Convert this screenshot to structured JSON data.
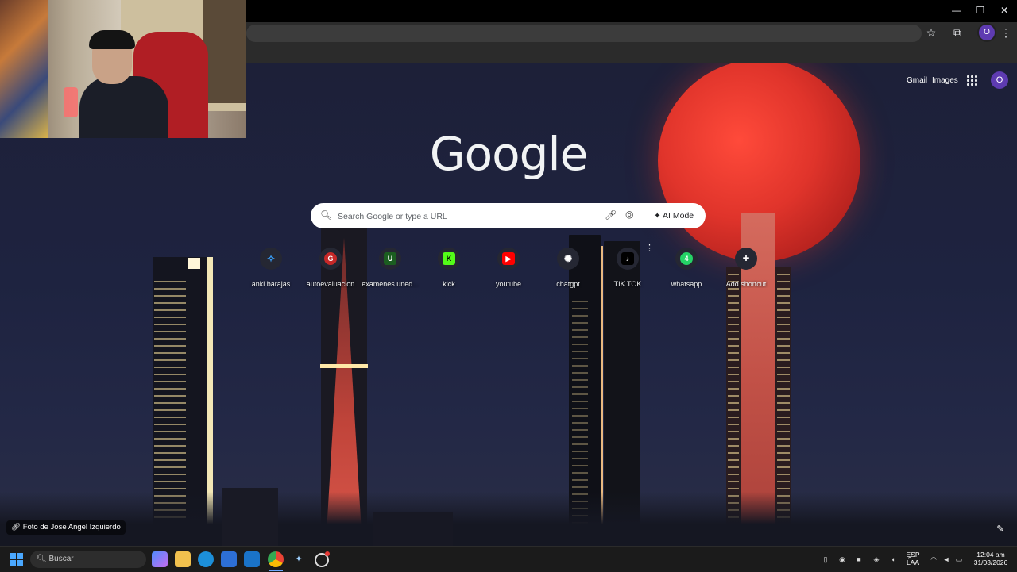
{
  "chrome": {
    "toolbar_icons": [
      "star-icon",
      "extensions-icon",
      "kebab-menu-icon"
    ],
    "profile_initial": "O"
  },
  "header": {
    "gmail": "Gmail",
    "images": "Images",
    "avatar_initial": "O"
  },
  "logo": "Google",
  "search": {
    "placeholder": "Search Google or type a URL",
    "ai_mode": "AI Mode"
  },
  "shortcuts": [
    {
      "label": "anki barajas",
      "icon": "anki-icon",
      "glyph": "✧",
      "color": "#3aa3ff"
    },
    {
      "label": "autoevaluacion",
      "icon": "autoevaluacion-icon",
      "glyph": "G",
      "color": "#c62828"
    },
    {
      "label": "examenes uned...",
      "icon": "uned-icon",
      "glyph": "U",
      "color": "#1b5e20"
    },
    {
      "label": "kick",
      "icon": "kick-icon",
      "glyph": "K",
      "color": "#53fc18"
    },
    {
      "label": "youtube",
      "icon": "youtube-icon",
      "glyph": "▶",
      "color": "#ff0000"
    },
    {
      "label": "chatgpt",
      "icon": "chatgpt-icon",
      "glyph": "✺",
      "color": "#ffffff"
    },
    {
      "label": "TIK TOK",
      "icon": "tiktok-icon",
      "glyph": "♪",
      "color": "#000000"
    },
    {
      "label": "whatsapp",
      "icon": "whatsapp-icon",
      "glyph": "4",
      "color": "#25d366"
    },
    {
      "label": "Add shortcut",
      "icon": "add-icon",
      "glyph": "+",
      "color": "#252733"
    }
  ],
  "credit": "Foto de Jose Angel Izquierdo",
  "taskbar": {
    "search_placeholder": "Buscar",
    "language": "ESP",
    "language_sub": "LAA",
    "time": "12:04 am",
    "date": "31/03/2026"
  },
  "colors": {
    "accent": "#5e3bb1",
    "moon": "#e0342b",
    "sky": "#1e2340"
  }
}
